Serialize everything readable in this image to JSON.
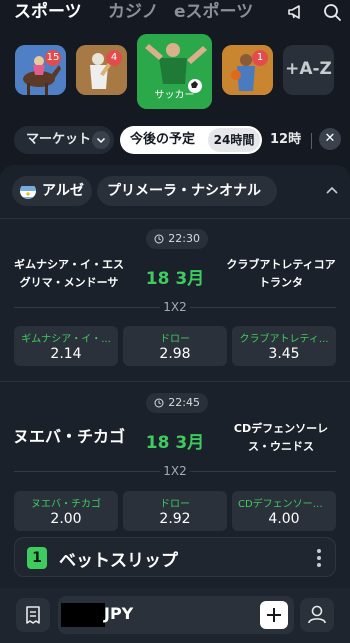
{
  "topnav": {
    "tabs": [
      {
        "label": "スポーツ",
        "active": true
      },
      {
        "label": "カジノ",
        "active": false
      },
      {
        "label": "eスポーツ",
        "active": false
      }
    ],
    "icons": [
      "megaphone-icon",
      "search-icon"
    ]
  },
  "sports": [
    {
      "name": "horse-racing",
      "badge": "15"
    },
    {
      "name": "cricket",
      "badge": "4"
    },
    {
      "name": "soccer",
      "label": "サッカー",
      "selected": true
    },
    {
      "name": "basketball",
      "badge": "1"
    },
    {
      "name": "all-sports",
      "label": "+A-Z"
    }
  ],
  "filters": {
    "market": "マーケット",
    "upcoming": "今後の予定",
    "range_24h": "24時間",
    "range_12h": "12時",
    "close_icon": "close-icon"
  },
  "league": {
    "country": "アルゼ",
    "name": "プリメーラ・ナシオナル"
  },
  "matches": [
    {
      "time": "22:30",
      "home": [
        "ギムナシア・イ・エス",
        "グリマ・メンドーサ"
      ],
      "away": [
        "クラブアトレティコア",
        "トランタ"
      ],
      "date": "18 3月",
      "market": "1X2",
      "odds": [
        {
          "name": "ギムナシア・イ・...",
          "value": "2.14"
        },
        {
          "name": "ドロー",
          "value": "2.98"
        },
        {
          "name": "クラブアトレティ...",
          "value": "3.45"
        }
      ]
    },
    {
      "time": "22:45",
      "home": [
        "ヌエバ・チカゴ"
      ],
      "away": [
        "CDデフェンソーレ",
        "ス・ウニドス"
      ],
      "date": "18 3月",
      "market": "1X2",
      "odds": [
        {
          "name": "ヌエバ・チカゴ",
          "value": "2.00"
        },
        {
          "name": "ドロー",
          "value": "2.92"
        },
        {
          "name": "CDデフェンソーレ...",
          "value": "4.00"
        }
      ]
    }
  ],
  "betslip": {
    "count": "1",
    "title": "ベットスリップ"
  },
  "bottombar": {
    "currency": "JPY"
  },
  "colors": {
    "accent": "#3ecc5f",
    "background": "#151a22",
    "badge": "#e24c4c"
  }
}
